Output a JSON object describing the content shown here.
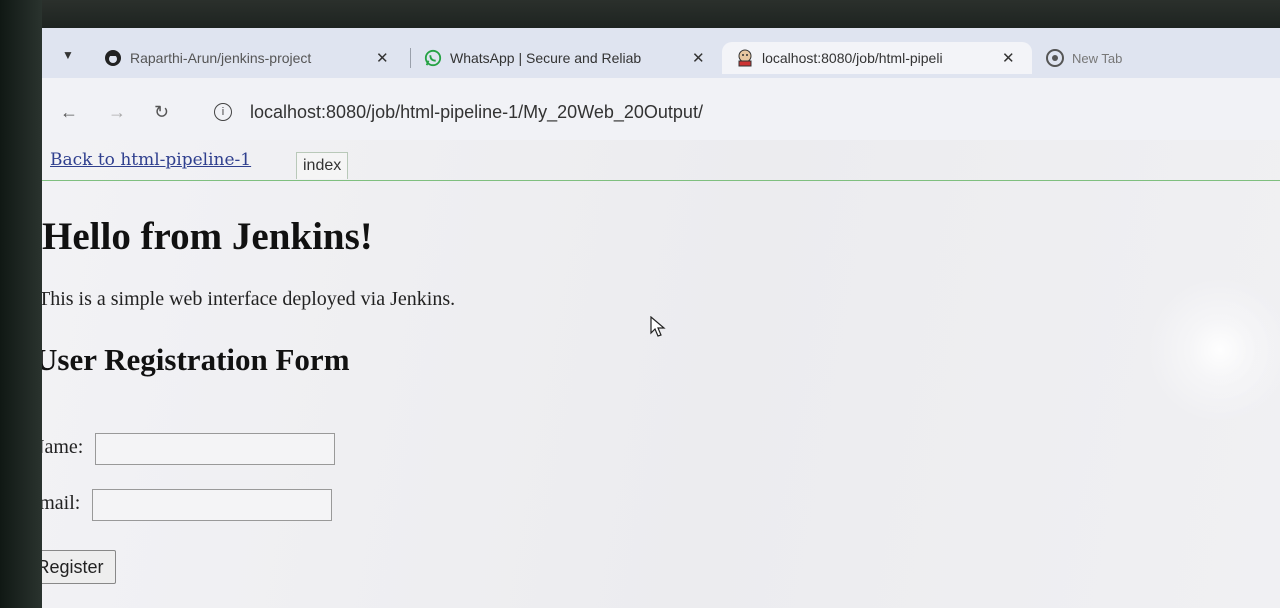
{
  "browser": {
    "tabs": [
      {
        "title": "Raparthi-Arun/jenkins-project",
        "icon": "github-icon",
        "active": false
      },
      {
        "title": "WhatsApp | Secure and Reliab",
        "icon": "whatsapp-icon",
        "active": false
      },
      {
        "title": "localhost:8080/job/html-pipeli",
        "icon": "jenkins-icon",
        "active": true
      },
      {
        "title": "New Tab",
        "icon": "chrome-icon",
        "active": false
      }
    ],
    "tab_close_glyph": "✕",
    "address": "localhost:8080/job/html-pipeline-1/My_20Web_20Output/"
  },
  "breadcrumb": {
    "back_link": "Back to html-pipeline-1",
    "tab": "index"
  },
  "content": {
    "heading": "Hello from Jenkins!",
    "intro": "This is a simple web interface deployed via Jenkins.",
    "form_title": "User Registration Form",
    "name_label": "Name:",
    "email_label": "Email:",
    "register_label": "Register"
  },
  "colors": {
    "link": "#2f3f8e",
    "breadcrumb_rule": "#7fbf7f",
    "tabstrip": "#dfe4f0"
  }
}
